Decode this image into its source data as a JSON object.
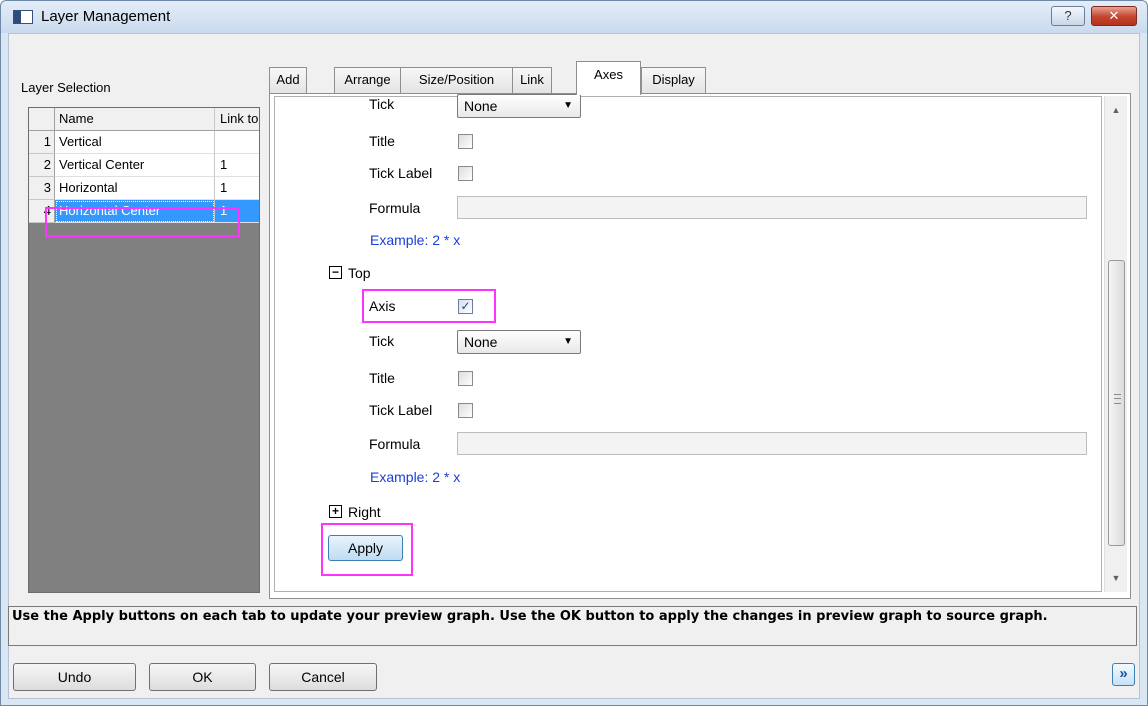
{
  "window": {
    "title": "Layer Management",
    "help_label": "?",
    "close_label": "✕"
  },
  "layer_selection": {
    "label": "Layer Selection",
    "columns": [
      "Name",
      "Link to"
    ],
    "rows": [
      {
        "index": "1",
        "name": "Vertical",
        "link": ""
      },
      {
        "index": "2",
        "name": "Vertical Center",
        "link": "1"
      },
      {
        "index": "3",
        "name": "Horizontal",
        "link": "1"
      },
      {
        "index": "4",
        "name": "Horizontal Center",
        "link": "1"
      }
    ],
    "selected_row": "4"
  },
  "tabs": [
    {
      "label": "Add"
    },
    {
      "label": "Arrange"
    },
    {
      "label": "Size/Position"
    },
    {
      "label": "Link"
    },
    {
      "label": "Axes"
    },
    {
      "label": "Display"
    }
  ],
  "active_tab": "Axes",
  "axes": {
    "bottom_partial": {
      "tick_label": "Tick",
      "tick_value": "None",
      "title_label": "Title",
      "title_checked": false,
      "ticklabel_label": "Tick Label",
      "ticklabel_checked": false,
      "formula_label": "Formula",
      "formula_value": "",
      "example": "Example: 2 * x"
    },
    "top": {
      "section": "Top",
      "expand_glyph": "−",
      "axis_label": "Axis",
      "axis_checked": true,
      "tick_label": "Tick",
      "tick_value": "None",
      "title_label": "Title",
      "title_checked": false,
      "ticklabel_label": "Tick Label",
      "ticklabel_checked": false,
      "formula_label": "Formula",
      "formula_value": "",
      "example": "Example: 2 * x"
    },
    "right": {
      "section": "Right",
      "expand_glyph": "+"
    },
    "apply_label": "Apply"
  },
  "status_text": "Use the Apply buttons on each tab to update your preview graph. Use the OK button to apply the changes in preview graph to source graph.",
  "buttons": {
    "undo": "Undo",
    "ok": "OK",
    "cancel": "Cancel",
    "more": "»"
  },
  "colors": {
    "highlight": "#ff33ff",
    "selection": "#3399ff",
    "example_link": "#1a3fd6"
  },
  "icons": {
    "window": "window-app-icon",
    "help": "help-icon",
    "close": "close-icon",
    "dropdown": "chevron-down-icon",
    "checkmark": "checkmark-icon",
    "collapse": "minus-box-icon",
    "expand": "plus-box-icon",
    "more": "double-chevron-right-icon"
  }
}
